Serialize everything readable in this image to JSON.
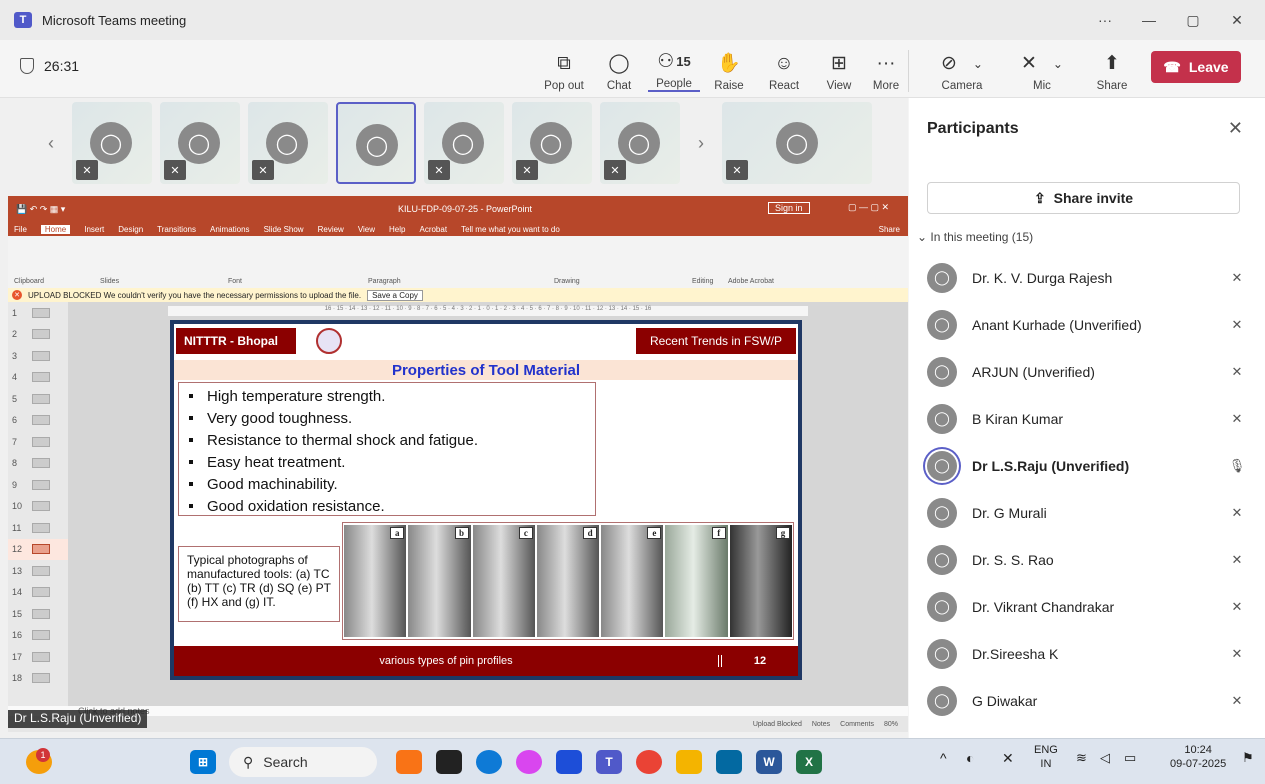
{
  "window": {
    "title": "Microsoft Teams meeting",
    "app_icon": "teams-icon",
    "controls": [
      "…",
      "—",
      "▢",
      "✕"
    ]
  },
  "meeting": {
    "timer": "26:31",
    "buttons": [
      {
        "id": "popout",
        "label": "Pop out",
        "icon": "popout-icon",
        "glyph": "⧉"
      },
      {
        "id": "chat",
        "label": "Chat",
        "icon": "chat-icon",
        "glyph": "☺"
      },
      {
        "id": "people",
        "label": "People",
        "icon": "people-icon",
        "glyph": "⚇",
        "count": "15"
      },
      {
        "id": "raise",
        "label": "Raise",
        "icon": "hand-icon",
        "glyph": "✋"
      },
      {
        "id": "react",
        "label": "React",
        "icon": "smile-icon",
        "glyph": "☺"
      },
      {
        "id": "view",
        "label": "View",
        "icon": "grid-icon",
        "glyph": "⊞"
      },
      {
        "id": "more",
        "label": "More",
        "icon": "more-icon",
        "glyph": "···"
      },
      {
        "id": "camera",
        "label": "Camera",
        "icon": "camera-off-icon",
        "glyph": "⊘"
      },
      {
        "id": "mic",
        "label": "Mic",
        "icon": "mic-muted-icon",
        "glyph": "🔇"
      },
      {
        "id": "share",
        "label": "Share",
        "icon": "share-icon",
        "glyph": "⬆"
      }
    ],
    "leave_label": "Leave"
  },
  "ppt": {
    "title": "KILU-FDP-09-07-25 - PowerPoint",
    "signin": "Sign in",
    "tabs": [
      "File",
      "Home",
      "Insert",
      "Design",
      "Transitions",
      "Animations",
      "Slide Show",
      "Review",
      "View",
      "Help",
      "Acrobat",
      "Tell me what you want to do"
    ],
    "share_label": "Share",
    "ribbon_groups": [
      "Clipboard",
      "Slides",
      "Font",
      "Paragraph",
      "Drawing",
      "Editing",
      "Adobe Acrobat"
    ],
    "warning": "UPLOAD BLOCKED  We couldn't verify you have the necessary permissions to upload the file.",
    "save_copy": "Save a Copy",
    "notes_placeholder": "Click to add notes",
    "status_items": [
      "Upload Blocked",
      "Notes",
      "Comments",
      "80%"
    ],
    "slide_numbers": [
      "1",
      "2",
      "3",
      "4",
      "5",
      "6",
      "7",
      "8",
      "9",
      "10",
      "11",
      "12",
      "13",
      "14",
      "15",
      "16",
      "17",
      "18"
    ],
    "current_slide": 12
  },
  "slide": {
    "left_header": "NITTTR - Bhopal",
    "right_header": "Recent Trends in FSW/P",
    "heading": "Properties of Tool Material",
    "bullets": [
      "High temperature strength.",
      "Very good toughness.",
      "Resistance to thermal shock and fatigue.",
      "Easy heat treatment.",
      "Good machinability.",
      "Good oxidation resistance."
    ],
    "caption": "Typical photographs of manufactured tools:  (a) TC (b) TT (c) TR (d) SQ (e) PT (f) HX and (g) IT.",
    "photo_labels": [
      "a",
      "b",
      "c",
      "d",
      "e",
      "f",
      "g"
    ],
    "footer": "various types of pin profiles",
    "page": "12"
  },
  "presenter": "Dr L.S.Raju (Unverified)",
  "panel": {
    "title": "Participants",
    "invite": "Share invite",
    "section": "In this meeting (15)",
    "participants": [
      {
        "name": "Dr. K. V. Durga Rajesh",
        "mic": "muted"
      },
      {
        "name": "Anant Kurhade (Unverified)",
        "mic": "muted"
      },
      {
        "name": "ARJUN (Unverified)",
        "mic": "muted"
      },
      {
        "name": "B Kiran Kumar",
        "mic": "muted"
      },
      {
        "name": "Dr L.S.Raju (Unverified)",
        "mic": "on"
      },
      {
        "name": "Dr. G Murali",
        "mic": "muted"
      },
      {
        "name": "Dr. S. S. Rao",
        "mic": "muted"
      },
      {
        "name": "Dr. Vikrant Chandrakar",
        "mic": "muted"
      },
      {
        "name": "Dr.Sireesha K",
        "mic": "muted"
      },
      {
        "name": "G Diwakar",
        "mic": "muted"
      }
    ]
  },
  "taskbar": {
    "search": "Search",
    "notification_count": "1",
    "lang": "ENG",
    "region": "IN",
    "time": "10:24",
    "date": "09-07-2025"
  }
}
